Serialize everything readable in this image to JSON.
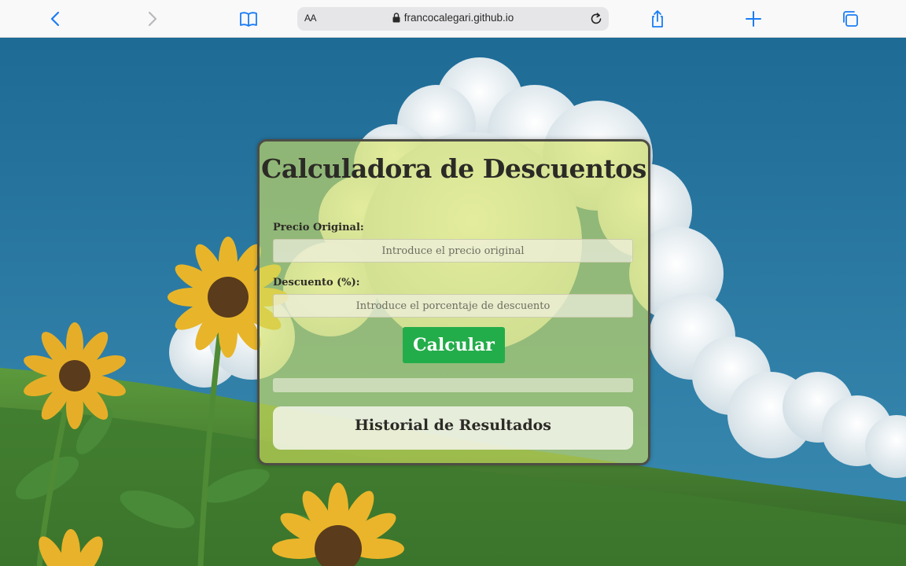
{
  "browser": {
    "text_size_label": "AA",
    "url": "francocalegari.github.io",
    "icons": [
      "back-icon",
      "forward-icon",
      "book-icon",
      "lock-icon",
      "reload-icon",
      "share-icon",
      "plus-icon",
      "tabs-icon"
    ],
    "accent": "#1a7cf5"
  },
  "calculator": {
    "title": "Calculadora de Descuentos",
    "price_label": "Precio Original:",
    "price_placeholder": "Introduce el precio original",
    "discount_label": "Descuento (%):",
    "discount_placeholder": "Introduce el porcentaje de descuento",
    "calc_button": "Calcular",
    "result": "",
    "history_title": "Historial de Resultados",
    "button_color": "#23ad4a"
  }
}
